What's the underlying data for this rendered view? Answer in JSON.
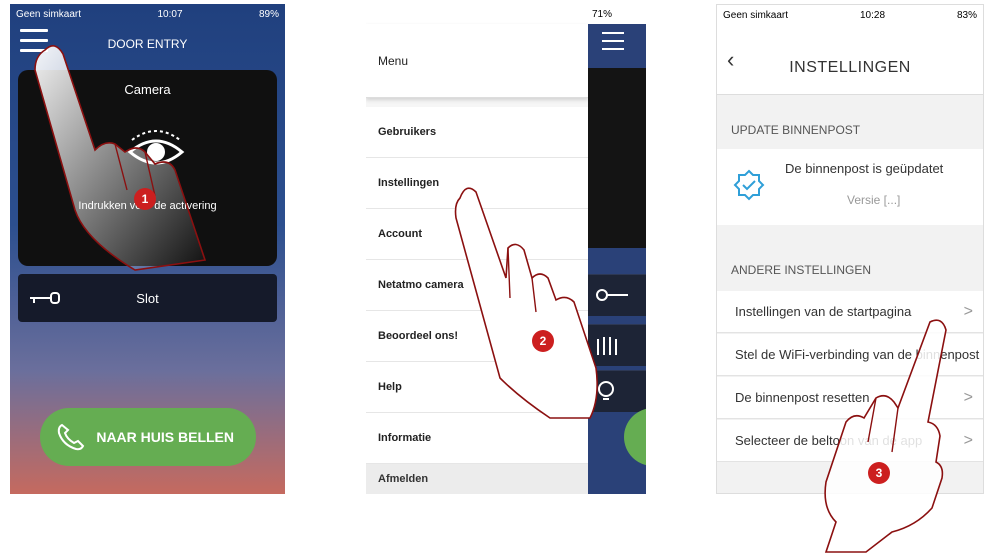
{
  "phone1": {
    "status": {
      "carrier": "Geen simkaart",
      "time": "10:07",
      "battery": "89%"
    },
    "title": "DOOR ENTRY",
    "camera": {
      "title": "Camera",
      "hint": "Indrukken voor de activering"
    },
    "lock_label": "Slot",
    "call_button": "NAAR HUIS BELLEN"
  },
  "phone2": {
    "status": {
      "right": "71%"
    },
    "menu_title": "Menu",
    "items": [
      "Gebruikers",
      "Instellingen",
      "Account",
      "Netatmo camera",
      "Beoordeel ons!",
      "Help",
      "Informatie"
    ],
    "footer": "Afmelden"
  },
  "phone3": {
    "status": {
      "carrier": "Geen simkaart",
      "time": "10:28",
      "battery": "83%"
    },
    "title": "INSTELLINGEN",
    "section_update": "UPDATE BINNENPOST",
    "update_text": "De binnenpost is geüpdatet",
    "update_version": "Versie [...]",
    "section_other": "ANDERE INSTELLINGEN",
    "settings": [
      "Instellingen van de startpagina",
      "Stel de WiFi-verbinding van de binnenpost in",
      "De binnenpost resetten",
      "Selecteer de beltoon van de app"
    ]
  },
  "steps": [
    "1",
    "2",
    "3"
  ],
  "colors": {
    "accent_red": "#cc1f1f",
    "call_green": "#65ad52",
    "header_blue": "#20407e"
  }
}
